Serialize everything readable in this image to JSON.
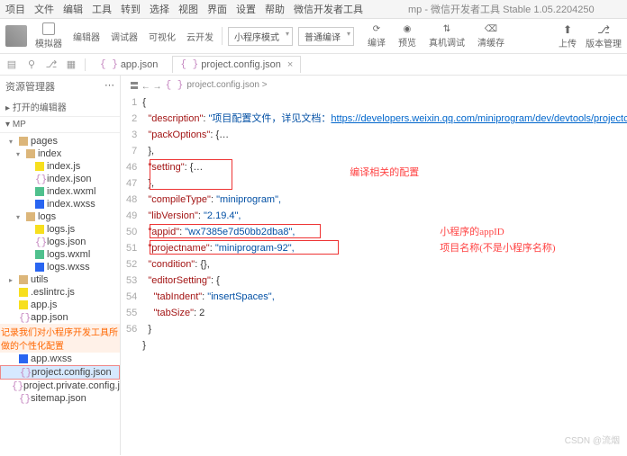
{
  "menu": [
    "项目",
    "文件",
    "编辑",
    "工具",
    "转到",
    "选择",
    "视图",
    "界面",
    "设置",
    "帮助",
    "微信开发者工具"
  ],
  "window_title": "mp - 微信开发者工具 Stable 1.05.2204250",
  "toolbar": {
    "tabs": [
      "模拟器",
      "编辑器",
      "调试器",
      "可视化",
      "云开发"
    ],
    "dd1": "小程序模式",
    "dd2": "普通编译",
    "mid_btns": [
      "编译",
      "预览",
      "真机调试",
      "清缓存"
    ],
    "right": [
      "上传",
      "版本管理"
    ]
  },
  "open_tabs": [
    {
      "name": "app.json",
      "active": false
    },
    {
      "name": "project.config.json",
      "active": true
    }
  ],
  "side": {
    "title": "资源管理器",
    "sec1": "打开的编辑器",
    "sec2": "MP",
    "tree": [
      {
        "n": "pages",
        "t": "folder",
        "lv": 0,
        "c": "▾"
      },
      {
        "n": "index",
        "t": "folder",
        "lv": 1,
        "c": "▾"
      },
      {
        "n": "index.js",
        "t": "js",
        "lv": 2
      },
      {
        "n": "index.json",
        "t": "json",
        "lv": 2
      },
      {
        "n": "index.wxml",
        "t": "wxml",
        "lv": 2
      },
      {
        "n": "index.wxss",
        "t": "wxss",
        "lv": 2
      },
      {
        "n": "logs",
        "t": "folder",
        "lv": 1,
        "c": "▾"
      },
      {
        "n": "logs.js",
        "t": "js",
        "lv": 2
      },
      {
        "n": "logs.json",
        "t": "json",
        "lv": 2
      },
      {
        "n": "logs.wxml",
        "t": "wxml",
        "lv": 2
      },
      {
        "n": "logs.wxss",
        "t": "wxss",
        "lv": 2
      },
      {
        "n": "utils",
        "t": "folder",
        "lv": 0,
        "c": "▸"
      },
      {
        "n": ".eslintrc.js",
        "t": "js",
        "lv": 0
      },
      {
        "n": "app.js",
        "t": "js",
        "lv": 0
      },
      {
        "n": "app.json",
        "t": "json",
        "lv": 0
      },
      {
        "n": "app.wxss",
        "t": "wxss",
        "lv": 0
      },
      {
        "n": "project.config.json",
        "t": "json",
        "lv": 0,
        "sel": true
      },
      {
        "n": "project.private.config.json",
        "t": "json",
        "lv": 0
      },
      {
        "n": "sitemap.json",
        "t": "json",
        "lv": 0
      }
    ],
    "overlay_note": "记录我们对小程序开发工具所做的个性化配置"
  },
  "breadcrumb": "project.config.json  >",
  "code": {
    "linenos": [
      "1",
      "2",
      "3",
      "",
      "7",
      "46",
      "47",
      "48",
      "49",
      "50",
      "51",
      "52",
      "53",
      "54",
      "55",
      "56"
    ],
    "l1": "{",
    "l2_k": "\"description\"",
    "l2_v": "\"项目配置文件，详见文档：",
    "l2_url": "https://developers.weixin.qq.com/miniprogram/dev/devtools/projectconfig.html",
    "l2_end": "\",",
    "l3_k": "\"packOptions\"",
    "l3_v": "{…",
    "l3b": "},",
    "l7_k": "\"setting\"",
    "l7_v": "{…",
    "l46": "},",
    "l47_k": "\"compileType\"",
    "l47_v": "\"miniprogram\",",
    "l48_k": "\"libVersion\"",
    "l48_v": "\"2.19.4\",",
    "l49_k": "\"appid\"",
    "l49_v": "\"wx7385e7d50bb2dba8\",",
    "l50_k": "\"projectname\"",
    "l50_v": "\"miniprogram-92\",",
    "l51_k": "\"condition\"",
    "l51_v": "{},",
    "l52_k": "\"editorSetting\"",
    "l52_v": "{",
    "l53_k": "\"tabIndent\"",
    "l53_v": "\"insertSpaces\",",
    "l54_k": "\"tabSize\"",
    "l54_v": "2",
    "l55": "}",
    "l56": "}"
  },
  "annots": {
    "a1": "编译相关的配置",
    "a2": "小程序的appID",
    "a3": "项目名称(不是小程序名称)"
  },
  "watermark": "CSDN @流烟"
}
